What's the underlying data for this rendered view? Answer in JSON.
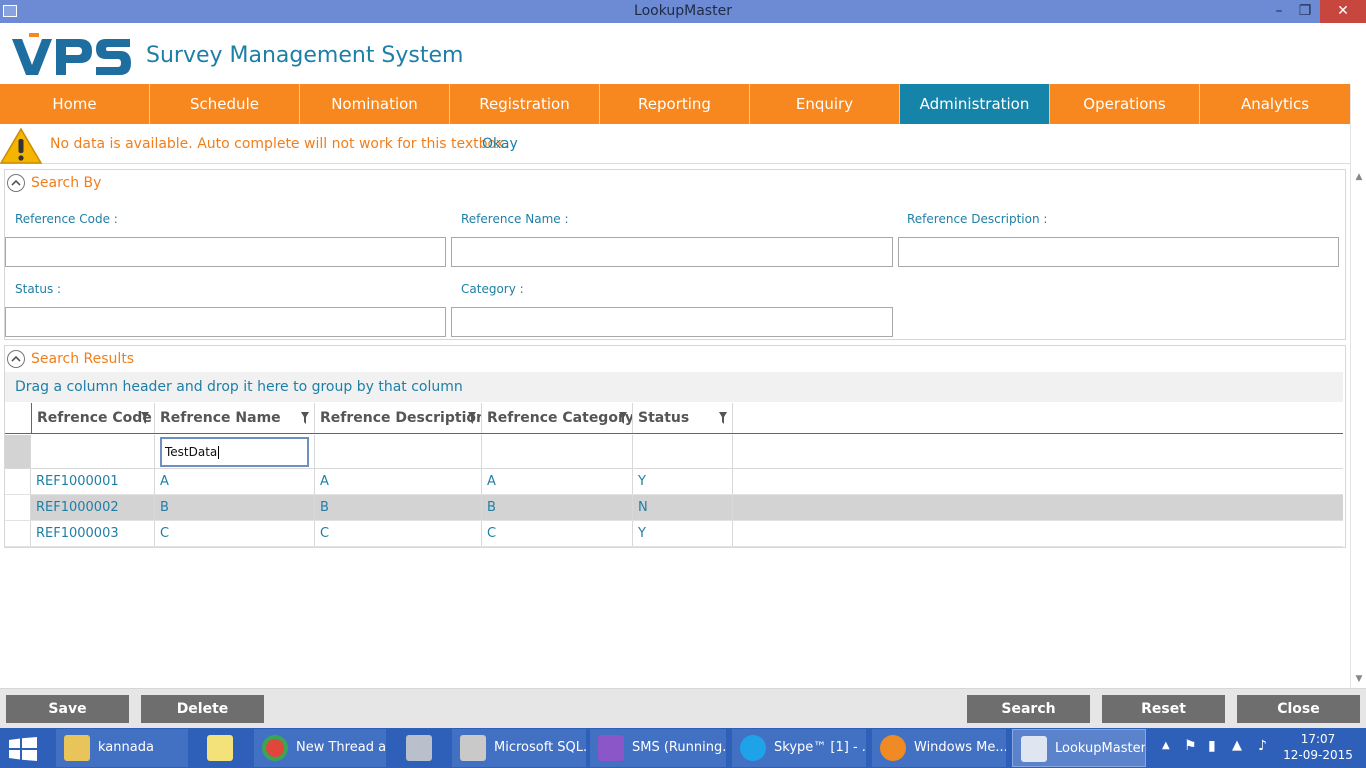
{
  "window": {
    "title": "LookupMaster"
  },
  "header": {
    "logo_text": "VPS",
    "app_name": "Survey Management System"
  },
  "nav": {
    "items": [
      "Home",
      "Schedule",
      "Nomination",
      "Registration",
      "Reporting",
      "Enquiry",
      "Administration",
      "Operations",
      "Analytics"
    ],
    "active": "Administration"
  },
  "alert": {
    "message": "No data is available. Auto complete will not work for this textbox.",
    "action": "Okay"
  },
  "search": {
    "title": "Search By",
    "fields": {
      "ref_code": {
        "label": "Reference Code :",
        "value": ""
      },
      "ref_name": {
        "label": "Reference Name :",
        "value": ""
      },
      "ref_desc": {
        "label": "Reference Description :",
        "value": ""
      },
      "status": {
        "label": "Status :",
        "value": ""
      },
      "category": {
        "label": "Category :",
        "value": ""
      }
    }
  },
  "results": {
    "title": "Search Results",
    "group_hint": "Drag a column header and drop it here to group by that column",
    "columns": [
      "Refrence Code",
      "Refrence Name",
      "Refrence Description",
      "Refrence Category",
      "Status"
    ],
    "filter_value": "TestData",
    "rows": [
      [
        "REF1000001",
        "A",
        "A",
        "A",
        "Y"
      ],
      [
        "REF1000002",
        "B",
        "B",
        "B",
        "N"
      ],
      [
        "REF1000003",
        "C",
        "C",
        "C",
        "Y"
      ]
    ]
  },
  "buttons": {
    "save": "Save",
    "delete": "Delete",
    "search": "Search",
    "reset": "Reset",
    "close": "Close"
  },
  "taskbar": {
    "items": [
      {
        "label": "kannada",
        "icon": "folder-icon",
        "color": "#e8c45a"
      },
      {
        "label": "",
        "icon": "sticky-notes-icon",
        "color": "#f3e27a"
      },
      {
        "label": "New Thread a...",
        "icon": "chrome-icon",
        "color": "#e0463a"
      },
      {
        "label": "",
        "icon": "tools-icon",
        "color": "#b9c0cc"
      },
      {
        "label": "Microsoft SQL...",
        "icon": "sql-server-icon",
        "color": "#c9c9c9"
      },
      {
        "label": "SMS (Running...",
        "icon": "visual-studio-icon",
        "color": "#8a56c8"
      },
      {
        "label": "Skype™ [1] - ...",
        "icon": "skype-icon",
        "color": "#1fa3e8"
      },
      {
        "label": "Windows Me...",
        "icon": "media-player-icon",
        "color": "#f08a24"
      },
      {
        "label": "LookupMaster",
        "icon": "app-window-icon",
        "color": "#dfe6f2"
      }
    ],
    "clock_time": "17:07",
    "clock_date": "12-09-2015"
  },
  "colors": {
    "nav": "#f7871f",
    "nav_active": "#1683a8",
    "accent": "#1e7fa6",
    "orange_text": "#f07e1c"
  }
}
